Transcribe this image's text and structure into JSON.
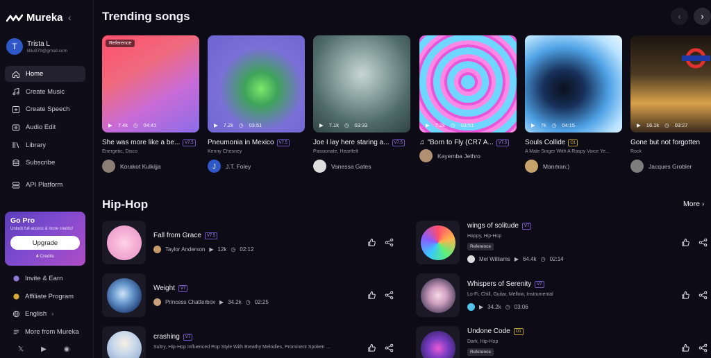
{
  "brand": {
    "name": "Mureka"
  },
  "user": {
    "name": "Trista L",
    "email": "lilliu979@gmail.com",
    "initial": "T"
  },
  "nav": [
    {
      "label": "Home",
      "icon": "home-icon"
    },
    {
      "label": "Create Music",
      "icon": "music-note-icon"
    },
    {
      "label": "Create Speech",
      "icon": "speech-icon"
    },
    {
      "label": "Audio Edit",
      "icon": "audio-edit-icon"
    },
    {
      "label": "Library",
      "icon": "library-icon"
    },
    {
      "label": "Subscribe",
      "icon": "subscribe-icon"
    },
    {
      "label": "API Platform",
      "icon": "api-icon"
    }
  ],
  "gopro": {
    "title": "Go Pro",
    "subtitle": "Unlock full access & more credits!",
    "button": "Upgrade",
    "credits": "4",
    "credits_label": "Credits"
  },
  "lower_nav": [
    {
      "label": "Invite & Earn"
    },
    {
      "label": "Affiliate Program"
    },
    {
      "label": "English"
    },
    {
      "label": "More from Mureka"
    }
  ],
  "trending": {
    "title": "Trending songs",
    "cards": [
      {
        "title": "She was more like a be...",
        "version": "V7.5",
        "sub": "Energetic, Disco",
        "artist": "Korakot Kulkijja",
        "plays": "7.4k",
        "duration": "04:41",
        "badge": "Reference"
      },
      {
        "title": "Pneumonia in Mexico",
        "version": "V7.5",
        "sub": "Kenny Chesney",
        "artist": "J.T. Foley",
        "plays": "7.2k",
        "duration": "03:51"
      },
      {
        "title": "Joe I lay here staring a...",
        "version": "V7.5",
        "sub": "Passionate, Heartfelt",
        "artist": "Vanessa Gates",
        "plays": "7.1k",
        "duration": "03:33"
      },
      {
        "title": "\"Born to Fly (CR7 A...",
        "version": "V7.5",
        "sub": "",
        "artist": "Kayemba Jethro",
        "plays": "7.2k",
        "duration": "03:51"
      },
      {
        "title": "Souls Collide",
        "version": "O1",
        "sub": "A Male Singer With A Raspy Voice Ye...",
        "artist": "Manman;)",
        "plays": "7k",
        "duration": "04:15"
      },
      {
        "title": "Gone but not forgotten",
        "version": "",
        "sub": "Rock",
        "artist": "Jacques Grobler",
        "plays": "16.1k",
        "duration": "03:27"
      }
    ]
  },
  "hiphop": {
    "title": "Hip-Hop",
    "more": "More",
    "rows": [
      {
        "title": "Fall from Grace",
        "version": "V7.5",
        "sub": "",
        "artist": "Taylor Anderson",
        "plays": "12k",
        "duration": "02:12",
        "reference": ""
      },
      {
        "title": "wings of solitude",
        "version": "V7",
        "sub": "Happy, Hip-Hop",
        "artist": "Mel Williams",
        "plays": "64.4k",
        "duration": "02:14",
        "reference": "Reference"
      },
      {
        "title": "Weight",
        "version": "V7",
        "sub": "",
        "artist": "Princess Chatterbox",
        "plays": "34.2k",
        "duration": "02:25",
        "reference": ""
      },
      {
        "title": "Whispers of Serenity",
        "version": "V7",
        "sub": "Lo-Fi, Chill, Guitar, Mellow, Instrumental",
        "artist": "",
        "plays": "34.2k",
        "duration": "03:06",
        "reference": ""
      },
      {
        "title": "crashing",
        "version": "V7",
        "sub": "Sultry, Hip-Hop Influenced Pop Style With Breathy Melodies, Prominent Spoken ...",
        "artist": "",
        "plays": "",
        "duration": "",
        "reference": ""
      },
      {
        "title": "Undone Code",
        "version": "O1",
        "sub": "Dark, Hip-Hop",
        "artist": "",
        "plays": "",
        "duration": "",
        "reference": "Reference"
      }
    ]
  },
  "colors": {
    "accent": "#6e55c8",
    "background": "#0d0b16",
    "sidebar": "#0f0d18"
  }
}
